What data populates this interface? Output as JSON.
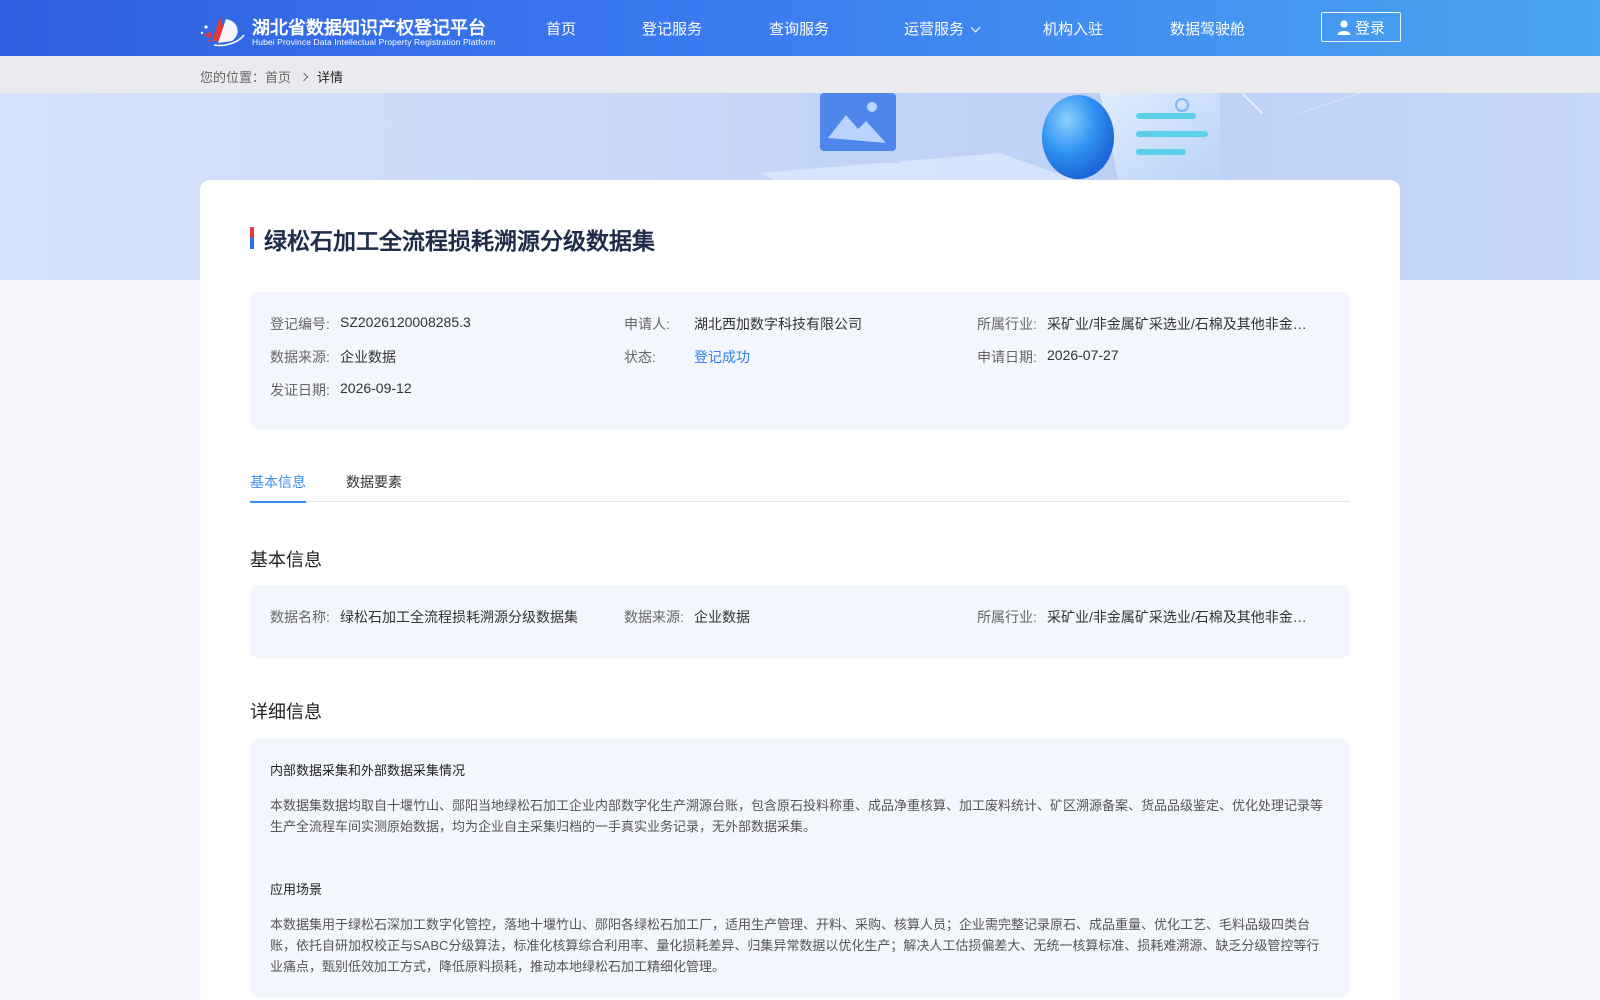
{
  "header": {
    "logo_title": "湖北省数据知识产权登记平台",
    "logo_subtitle": "Hubei Province Data Intellectual Property Registration Platform",
    "nav": [
      {
        "label": "首页"
      },
      {
        "label": "登记服务"
      },
      {
        "label": "查询服务"
      },
      {
        "label": "运营服务"
      },
      {
        "label": "机构入驻"
      },
      {
        "label": "数据驾驶舱"
      }
    ],
    "login_label": "登录",
    "icons": {
      "user": "user-icon",
      "dropdown": "chevron-down-icon"
    }
  },
  "breadcrumb": {
    "prefix": "您的位置：",
    "home": "首页",
    "current": "详情"
  },
  "detail": {
    "title": "绿松石加工全流程损耗溯源分级数据集",
    "summary": {
      "reg_no_label": "登记编号:",
      "reg_no": "SZ2026120008285.3",
      "applicant_label": "申请人:",
      "applicant": "湖北西加数字科技有限公司",
      "industry_label": "所属行业:",
      "industry": "采矿业/非金属矿采选业/石棉及其他非金属矿采选",
      "source_label": "数据来源:",
      "source": "企业数据",
      "status_label": "状态:",
      "status": "登记成功",
      "apply_date_label": "申请日期:",
      "apply_date": "2026-07-27",
      "issue_date_label": "发证日期:",
      "issue_date": "2026-09-12"
    },
    "tabs": [
      {
        "label": "基本信息"
      },
      {
        "label": "数据要素"
      }
    ],
    "basic": {
      "heading": "基本信息",
      "name_label": "数据名称:",
      "name": "绿松石加工全流程损耗溯源分级数据集",
      "source_label": "数据来源:",
      "source": "企业数据",
      "industry_label": "所属行业:",
      "industry": "采矿业/非金属矿采选业/石棉及其他非金属矿采选"
    },
    "details": {
      "heading": "详细信息",
      "collection_heading": "内部数据采集和外部数据采集情况",
      "collection_text": "本数据集数据均取自十堰竹山、郧阳当地绿松石加工企业内部数字化生产溯源台账，包含原石投料称重、成品净重核算、加工废料统计、矿区溯源备案、货品品级鉴定、优化处理记录等生产全流程车间实测原始数据，均为企业自主采集归档的一手真实业务记录，无外部数据采集。",
      "scenario_heading": "应用场景",
      "scenario_text": "本数据集用于绿松石深加工数字化管控，落地十堰竹山、郧阳各绿松石加工厂，适用生产管理、开料、采购、核算人员；企业需完整记录原石、成品重量、优化工艺、毛料品级四类台账，依托自研加权校正与SABC分级算法，标准化核算综合利用率、量化损耗差异、归集异常数据以优化生产；解决人工估损偏差大、无统一核算标准、损耗难溯源、缺乏分级管控等行业痛点，甄别低效加工方式，降低原料损耗，推动本地绿松石加工精细化管理。"
    }
  },
  "colors": {
    "header_start": "#2f5fe0",
    "header_end": "#4aa6ef",
    "accent": "#3d8ff3",
    "status": "#2d7ff0",
    "panel_bg": "#f3f6fd"
  }
}
